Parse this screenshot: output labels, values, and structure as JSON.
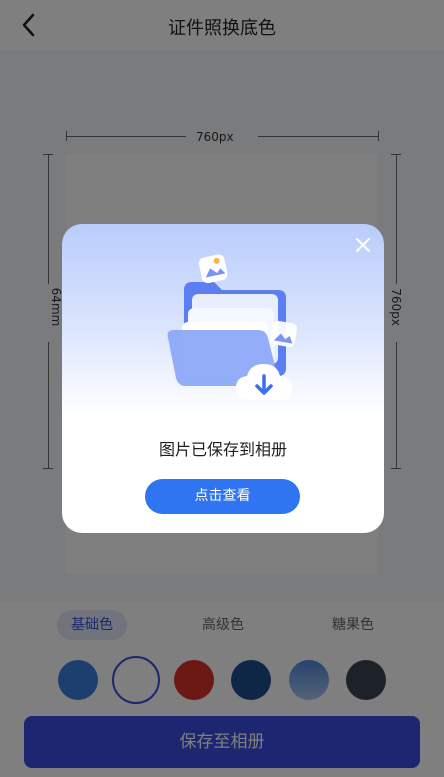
{
  "header": {
    "title": "证件照换底色"
  },
  "preview": {
    "width_label": "760px",
    "left_height_label": "64mm",
    "right_height_label": "760px"
  },
  "tabs": [
    {
      "label": "基础色",
      "active": true
    },
    {
      "label": "高级色",
      "active": false
    },
    {
      "label": "糖果色",
      "active": false
    }
  ],
  "swatches": [
    {
      "name": "blue",
      "color": "#3b7fe0"
    },
    {
      "name": "white",
      "color": "#ffffff",
      "selected": true
    },
    {
      "name": "red",
      "color": "#d9312a"
    },
    {
      "name": "dark-blue",
      "color": "#1f4f8f"
    },
    {
      "name": "gradient-blue",
      "color": "#6d9ee6"
    },
    {
      "name": "dark-gray",
      "color": "#3a4350"
    }
  ],
  "save_button": {
    "label": "保存至相册"
  },
  "modal": {
    "message": "图片已保存到相册",
    "view_button": "点击查看"
  },
  "colors": {
    "accent": "#3a4de0",
    "modal_button": "#2f74f0"
  }
}
